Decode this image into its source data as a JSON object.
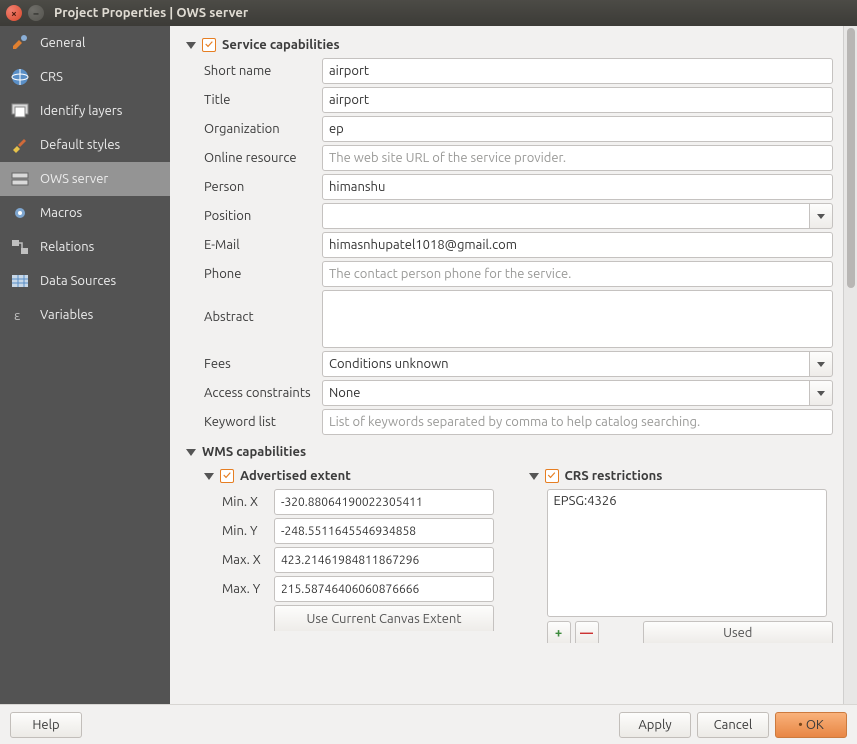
{
  "window": {
    "title": "Project Properties | OWS server"
  },
  "sidebar": {
    "items": [
      {
        "label": "General"
      },
      {
        "label": "CRS"
      },
      {
        "label": "Identify layers"
      },
      {
        "label": "Default styles"
      },
      {
        "label": "OWS server"
      },
      {
        "label": "Macros"
      },
      {
        "label": "Relations"
      },
      {
        "label": "Data Sources"
      },
      {
        "label": "Variables"
      }
    ]
  },
  "service": {
    "heading": "Service capabilities",
    "labels": {
      "short_name": "Short name",
      "title": "Title",
      "organization": "Organization",
      "online_resource": "Online resource",
      "person": "Person",
      "position": "Position",
      "email": "E-Mail",
      "phone": "Phone",
      "abstract": "Abstract",
      "fees": "Fees",
      "access_constraints": "Access constraints",
      "keyword_list": "Keyword list"
    },
    "values": {
      "short_name": "airport",
      "title": "airport",
      "organization": "ep",
      "online_resource": "",
      "person": "himanshu",
      "position": "",
      "email": "himasnhupatel1018@gmail.com",
      "phone": "",
      "abstract": "",
      "fees": "Conditions unknown",
      "access_constraints": "None",
      "keyword_list": ""
    },
    "placeholders": {
      "online_resource": "The web site URL of the service provider.",
      "phone": "The contact person phone for the service.",
      "keyword_list": "List of keywords separated by comma to help catalog searching."
    }
  },
  "wms": {
    "heading": "WMS capabilities",
    "advertised_extent": {
      "heading": "Advertised extent",
      "labels": {
        "minx": "Min. X",
        "miny": "Min. Y",
        "maxx": "Max. X",
        "maxy": "Max. Y"
      },
      "values": {
        "minx": "-320.88064190022305411",
        "miny": "-248.5511645546934858",
        "maxx": "423.21461984811867296",
        "maxy": "215.58746406060876666"
      },
      "use_current": "Use Current Canvas Extent"
    },
    "crs_restrictions": {
      "heading": "CRS restrictions",
      "items": [
        "EPSG:4326"
      ],
      "used_label": "Used"
    }
  },
  "footer": {
    "help": "Help",
    "apply": "Apply",
    "cancel": "Cancel",
    "ok": "OK"
  }
}
